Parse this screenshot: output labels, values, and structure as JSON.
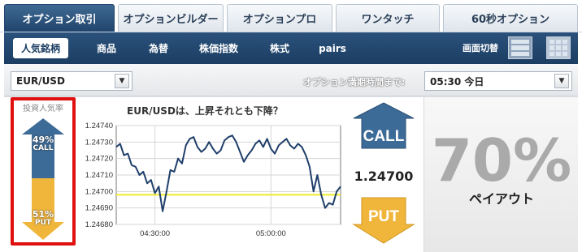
{
  "top_tabs": [
    {
      "label": "オプション取引",
      "active": true
    },
    {
      "label": "オプションビルダー",
      "active": false
    },
    {
      "label": "オプションプロ",
      "active": false
    },
    {
      "label": "ワンタッチ",
      "active": false
    },
    {
      "label": "60秒オプション",
      "active": false
    }
  ],
  "subnav": {
    "items": [
      {
        "label": "人気銘柄",
        "active": true
      },
      {
        "label": "商品",
        "active": false
      },
      {
        "label": "為替",
        "active": false
      },
      {
        "label": "株価指数",
        "active": false
      },
      {
        "label": "株式",
        "active": false
      },
      {
        "label": "pairs",
        "active": false
      }
    ],
    "view_label": "画面切替",
    "view_icons": [
      "list-view-icon",
      "grid-view-icon"
    ]
  },
  "controls": {
    "asset_value": "EUR/USD",
    "expiry_label": "オプション満期時間まで:",
    "expiry_value": "05:30 今日"
  },
  "sentiment": {
    "title": "投資人気率",
    "call_pct": "49%",
    "call_label": "CALL",
    "put_pct": "51%",
    "put_label": "PUT",
    "call_fraction": 0.49
  },
  "chart_title": "EUR/USDは、上昇それとも下降？",
  "chart_data": {
    "type": "line",
    "title": "",
    "xlabel": "",
    "ylabel": "",
    "yticks": [
      "1.24740",
      "1.24730",
      "1.24720",
      "1.24710",
      "1.24700",
      "1.24690",
      "1.24680"
    ],
    "xticks": [
      {
        "label": "04:30:00",
        "x": 5
      },
      {
        "label": "05:00:00",
        "x": 35
      }
    ],
    "xlim": [
      -5,
      53
    ],
    "ylim": [
      1.2468,
      1.2474
    ],
    "reference_line": 1.24698,
    "grid": true,
    "series": [
      {
        "x": [
          -5,
          -4,
          -3,
          -2,
          -1,
          0,
          1,
          2,
          3,
          4,
          5,
          6,
          7,
          8,
          9,
          10,
          11,
          12,
          13,
          14,
          15,
          16,
          17,
          18,
          19,
          20,
          21,
          22,
          23,
          24,
          25,
          26,
          27,
          28,
          29,
          30,
          31,
          32,
          33,
          34,
          35,
          36,
          37,
          38,
          39,
          40,
          41,
          42,
          43,
          44,
          45,
          46,
          47,
          48,
          49,
          50,
          51,
          52,
          53
        ],
        "values": [
          1.24727,
          1.24729,
          1.24722,
          1.24723,
          1.24716,
          1.24715,
          1.2471,
          1.24712,
          1.24705,
          1.24707,
          1.24699,
          1.24703,
          1.24688,
          1.247,
          1.24713,
          1.24712,
          1.2472,
          1.24717,
          1.24728,
          1.24732,
          1.24733,
          1.24727,
          1.24724,
          1.24726,
          1.2473,
          1.24726,
          1.24723,
          1.24725,
          1.24731,
          1.24733,
          1.24734,
          1.2473,
          1.24724,
          1.24718,
          1.24722,
          1.24725,
          1.24729,
          1.24731,
          1.24727,
          1.24732,
          1.24726,
          1.24723,
          1.24728,
          1.2473,
          1.24732,
          1.24728,
          1.24726,
          1.24729,
          1.24727,
          1.24722,
          1.24715,
          1.247,
          1.2471,
          1.24698,
          1.2469,
          1.24693,
          1.24692,
          1.247,
          1.24703
        ],
        "color": "#1f3f6a"
      }
    ],
    "reference_color": "#f1ea2a"
  },
  "trade": {
    "call_label": "CALL",
    "put_label": "PUT",
    "price": "1.24700",
    "call_color": "#3d6b97",
    "put_color": "#f0b63c"
  },
  "payout": {
    "percent": "70%",
    "label": "ペイアウト"
  }
}
